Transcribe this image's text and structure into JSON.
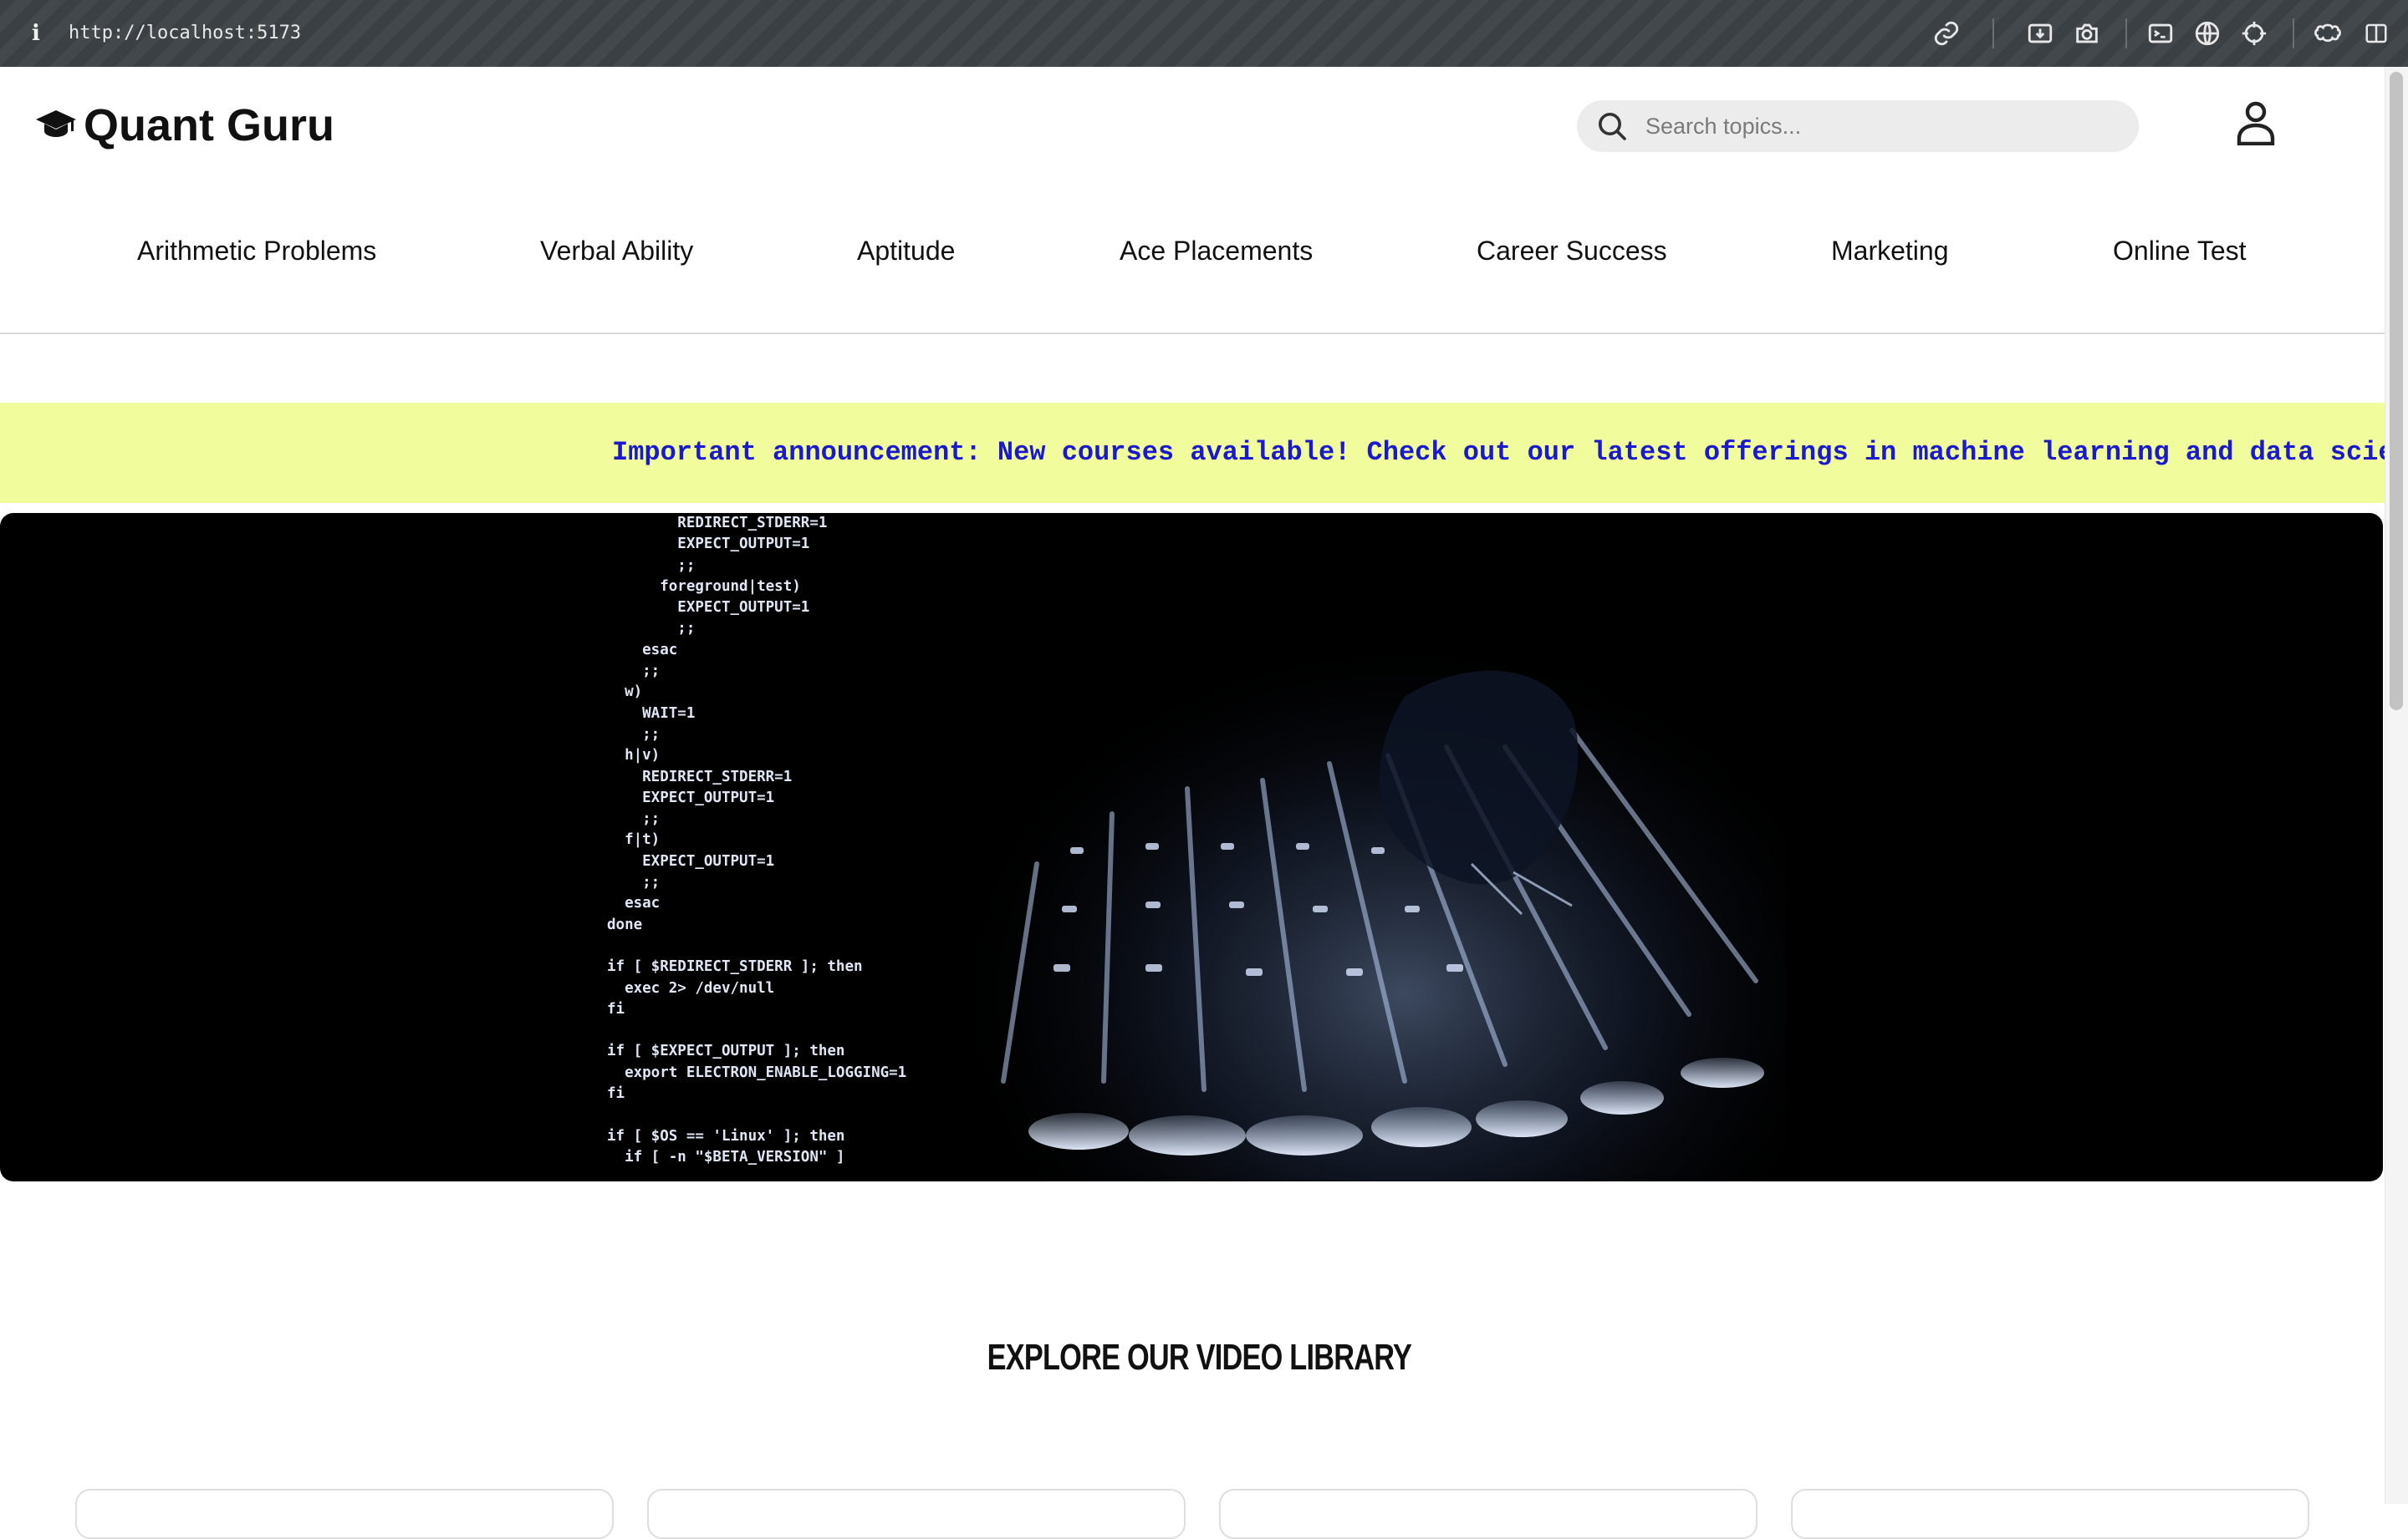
{
  "browser": {
    "url": "http://localhost:5173",
    "toolbar_icons": [
      "link-icon",
      "download-icon",
      "camera-icon",
      "terminal-icon",
      "globe-icon",
      "crosshair-icon",
      "extensions-icon",
      "sidebar-icon"
    ]
  },
  "header": {
    "logo_text": "Quant Guru",
    "logo_icon": "graduation-cap-icon",
    "search_placeholder": "Search topics...",
    "user_icon": "user-icon"
  },
  "nav": {
    "items": [
      {
        "label": "Arithmetic Problems"
      },
      {
        "label": "Verbal Ability"
      },
      {
        "label": "Aptitude"
      },
      {
        "label": "Ace Placements"
      },
      {
        "label": "Career Success"
      },
      {
        "label": "Marketing"
      },
      {
        "label": "Online Test"
      }
    ]
  },
  "announcement": {
    "text": "Important announcement: New courses available! Check out our latest offerings in machine learning and data science."
  },
  "hero": {
    "code_lines": [
      "        REDIRECT_STDERR=1",
      "        EXPECT_OUTPUT=1",
      "        ;;",
      "      foreground|test)",
      "        EXPECT_OUTPUT=1",
      "        ;;",
      "    esac",
      "    ;;",
      "  w)",
      "    WAIT=1",
      "    ;;",
      "  h|v)",
      "    REDIRECT_STDERR=1",
      "    EXPECT_OUTPUT=1",
      "    ;;",
      "  f|t)",
      "    EXPECT_OUTPUT=1",
      "    ;;",
      "  esac",
      "done",
      "",
      "if [ $REDIRECT_STDERR ]; then",
      "  exec 2> /dev/null",
      "fi",
      "",
      "if [ $EXPECT_OUTPUT ]; then",
      "  export ELECTRON_ENABLE_LOGGING=1",
      "fi",
      "",
      "if [ $OS == 'Linux' ]; then",
      "  if [ -n \"$BETA_VERSION\" ]"
    ]
  },
  "library": {
    "title": "EXPLORE OUR VIDEO LIBRARY"
  },
  "colors": {
    "announcement_bg": "#f1fd9c",
    "announcement_text": "#1a1acc",
    "chrome_bg": "#3b4045"
  }
}
